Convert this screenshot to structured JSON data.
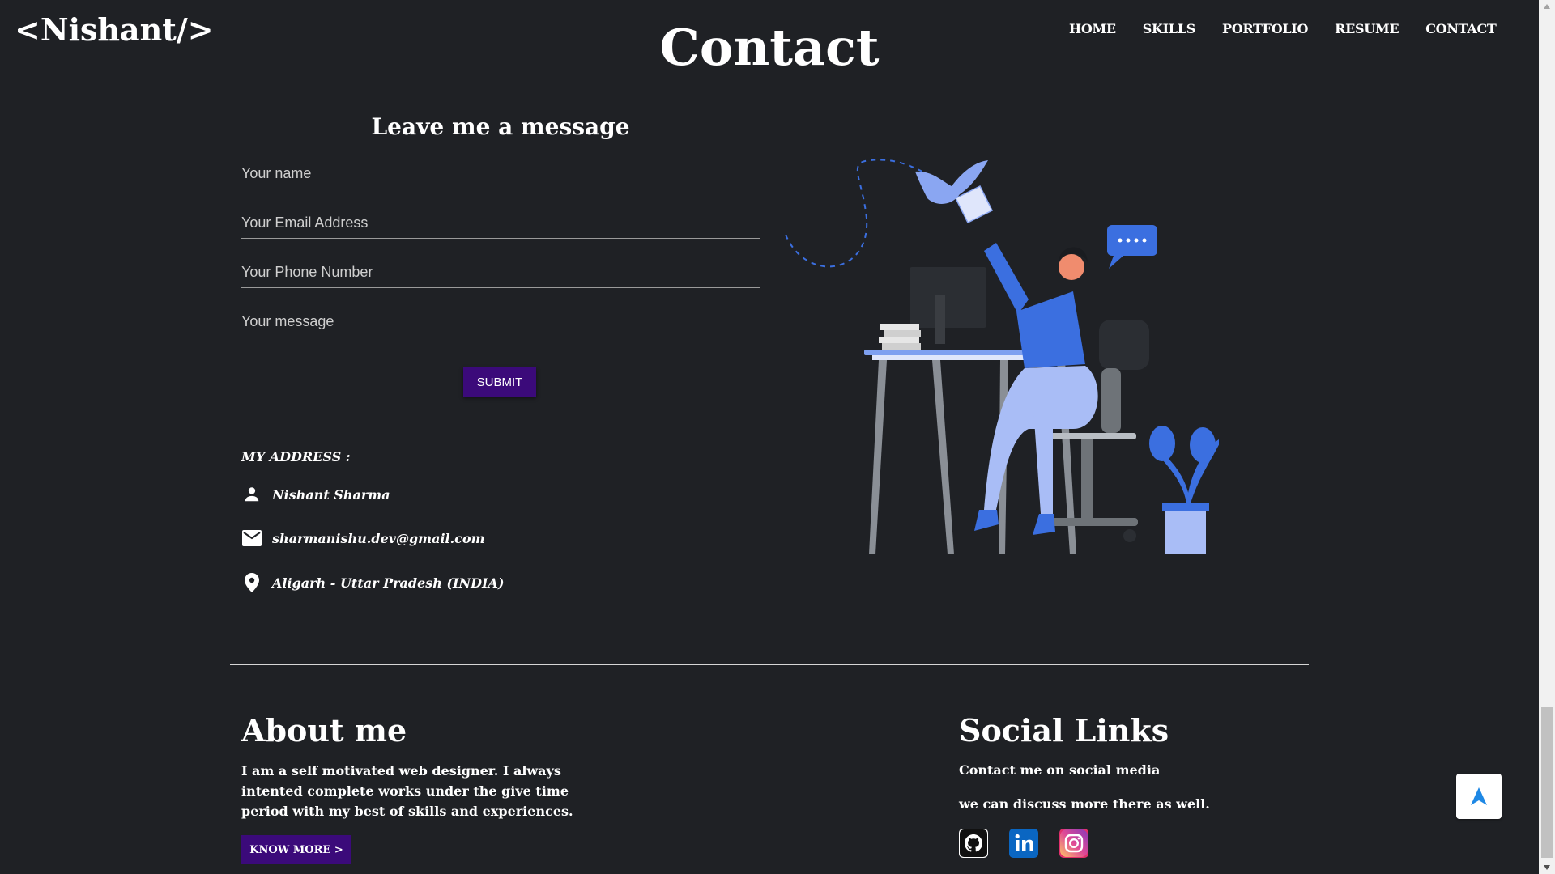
{
  "header": {
    "logo": "<Nishant/>",
    "title": "Contact",
    "nav": [
      "HOME",
      "SKILLS",
      "PORTFOLIO",
      "RESUME",
      "CONTACT"
    ]
  },
  "form": {
    "title": "Leave me a message",
    "name_placeholder": "Your name",
    "email_placeholder": "Your Email Address",
    "phone_placeholder": "Your Phone Number",
    "message_placeholder": "Your message",
    "submit_label": "SUBMIT"
  },
  "address": {
    "title": "MY ADDRESS :",
    "name": "Nishant Sharma",
    "email": "sharmanishu.dev@gmail.com",
    "location": "Aligarh - Uttar Pradesh (INDIA)"
  },
  "about": {
    "title": "About me",
    "text": "I am a self motivated web designer. I always intented complete works under the give time period with my best of skills and experiences.",
    "button": "KNOW MORE >"
  },
  "social": {
    "title": "Social Links",
    "line1": "Contact me on social media",
    "line2": "we can discuss more there as well.",
    "icons": [
      "github-icon",
      "linkedin-icon",
      "instagram-icon"
    ]
  },
  "colors": {
    "background": "#1f2125",
    "button": "#3b0a7a",
    "accent_blue": "#3b6fe0"
  }
}
